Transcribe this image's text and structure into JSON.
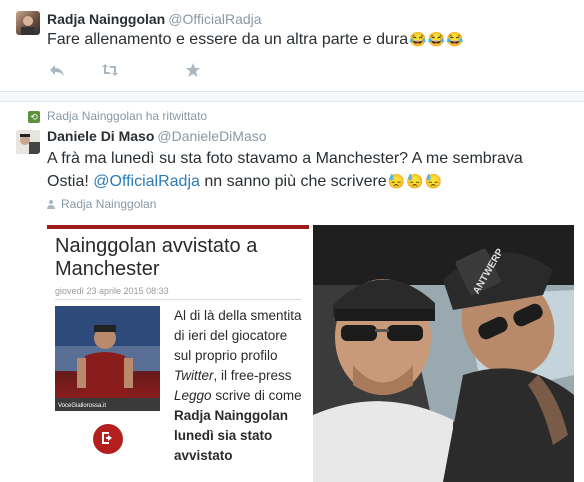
{
  "tweet1": {
    "name": "Radja Nainggolan",
    "handle": "@OfficialRadja",
    "text": "Fare allenamento e essere da un altra parte e dura",
    "emoji": [
      "😂",
      "😂",
      "😂"
    ]
  },
  "actions": {
    "reply_icon": "reply-icon",
    "retweet_icon": "retweet-icon",
    "favorite_icon": "favorite-star-icon"
  },
  "tweet2": {
    "retweet_note": "Radja Nainggolan ha ritwittato",
    "name": "Daniele Di Maso",
    "handle": "@DanieleDiMaso",
    "text_before": "A frà ma lunedì su sta foto stavamo a Manchester? A me sembrava Ostia!",
    "mention": "@OfficialRadja",
    "text_after": "nn sanno più che scrivere",
    "emoji": [
      "😓",
      "😓",
      "😓"
    ],
    "context_user": "Radja Nainggolan"
  },
  "article": {
    "title": "Nainggolan avvistato a Manchester",
    "date": "giovedì 23 aprile 2015 08:33",
    "photo_caption": "VoceGiallorossa.it",
    "body_1": "Al di là della smentita di ieri del giocatore sul proprio profilo",
    "body_twitter": "Twitter",
    "body_2": ", il free-press",
    "body_leggo": "Leggo",
    "body_3": "scrive di come",
    "body_bold": "Radja Nainggolan lunedì sia stato avvistato",
    "exit_icon": "exit-icon"
  },
  "photo": {
    "cap_text": "ANTWERP"
  },
  "colors": {
    "accent": "#2b7bb9",
    "muted": "#8899a6",
    "article_red": "#9e1b1b"
  }
}
